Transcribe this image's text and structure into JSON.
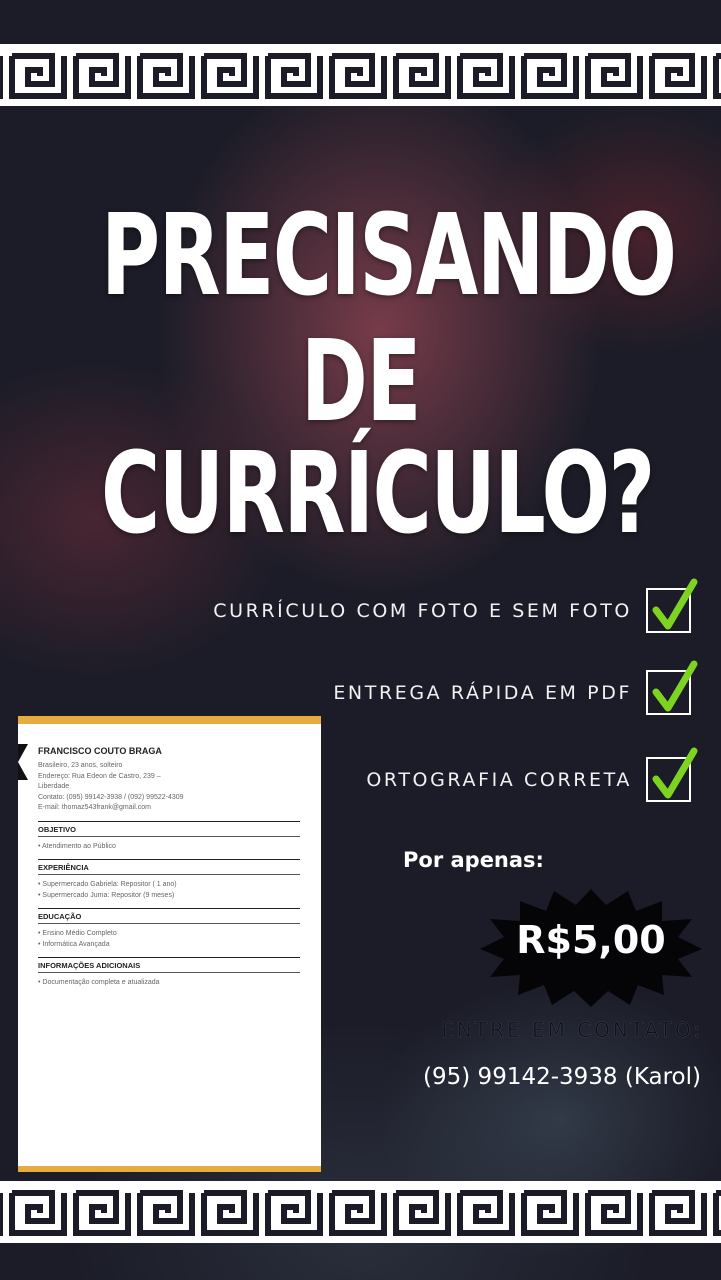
{
  "headline": {
    "line1": "PRECISANDO",
    "line2": "DE CURRÍCULO?"
  },
  "features": [
    {
      "label": "CURRÍCULO COM FOTO E SEM FOTO",
      "icon": "checkbox-check-icon"
    },
    {
      "label": "ENTREGA RÁPIDA EM PDF",
      "icon": "checkbox-check-icon"
    },
    {
      "label": "ORTOGRAFIA CORRETA",
      "icon": "checkbox-check-icon"
    }
  ],
  "resume": {
    "name": "FRANCISCO COUTO BRAGA",
    "info": [
      "Brasileiro, 23 anos, solteiro",
      "Endereço: Rua Edeon de Castro, 239 –",
      "Liberdade",
      "Contato: (095) 99142-3938 / (092) 99522-4309",
      "E-mail: thomaz543frank@gmail.com"
    ],
    "sections": [
      {
        "title": "OBJETIVO",
        "items": [
          "• Atendimento ao Público"
        ]
      },
      {
        "title": "EXPERIÊNCIA",
        "items": [
          "• Supermercado Gabriela: Repositor ( 1 ano)",
          "• Supermercado Juma: Repositor (9 meses)"
        ]
      },
      {
        "title": "EDUCAÇÃO",
        "items": [
          "• Ensino Médio Completo",
          "• Informática Avançada"
        ]
      },
      {
        "title": "INFORMAÇÕES ADICIONAIS",
        "items": [
          "• Documentação completa e atualizada"
        ]
      }
    ]
  },
  "offer": {
    "lead": "Por apenas:",
    "price": "R$5,00"
  },
  "contact": {
    "label": "ENTRE EM CONTATO:",
    "phone": "(95) 99142-3938 (Karol)"
  },
  "colors": {
    "accent_gold": "#e6ad3e",
    "check_green": "#7ed321",
    "background": "#1b1c27"
  }
}
